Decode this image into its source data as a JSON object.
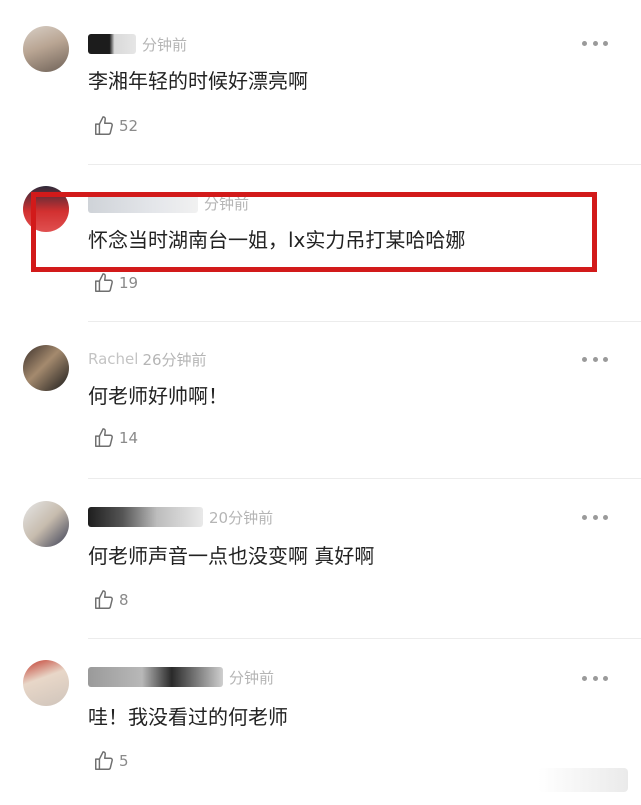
{
  "comments": [
    {
      "time": "分钟前",
      "text": "李湘年轻的时候好漂亮啊",
      "likes": "52"
    },
    {
      "time": "分钟前",
      "text": "怀念当时湖南台一姐，lx实力吊打某哈哈娜",
      "likes": "19"
    },
    {
      "name": "Rachel",
      "time": "26分钟前",
      "text": "何老师好帅啊！",
      "likes": "14"
    },
    {
      "time": "20分钟前",
      "text": "何老师声音一点也没变啊 真好啊",
      "likes": "8"
    },
    {
      "time": "分钟前",
      "text": "哇！我没看过的何老师",
      "likes": "5"
    }
  ],
  "colors": {
    "highlight": "#d21a1a",
    "text": "#222222",
    "meta": "#b5b5b5"
  },
  "icons": {
    "like": "thumb-up-icon",
    "more": "more-dots-icon"
  }
}
